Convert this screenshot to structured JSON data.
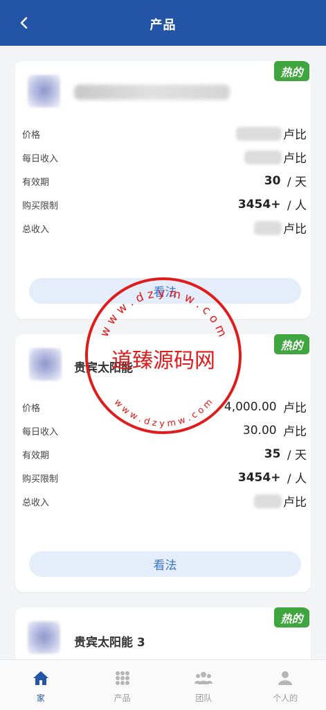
{
  "header": {
    "title": "产品"
  },
  "hot_badge": "热的",
  "labels": {
    "price": "价格",
    "daily": "每日收入",
    "validity": "有效期",
    "limit": "购买限制",
    "total": "总收入"
  },
  "cards": [
    {
      "name": "",
      "price": "",
      "price_unit": "卢比",
      "daily": "",
      "daily_unit": "卢比",
      "validity": "30",
      "validity_unit": "/ 天",
      "limit": "3454+",
      "limit_unit": "/ 人",
      "total": "",
      "total_unit": "卢比",
      "button": "看法"
    },
    {
      "name": "贵宾太阳能",
      "price": "4,000.00",
      "price_unit": "卢比",
      "daily": "30.00",
      "daily_unit": "卢比",
      "validity": "35",
      "validity_unit": "/ 天",
      "limit": "3454+",
      "limit_unit": "/ 人",
      "total": "",
      "total_unit": "卢比",
      "button": "看法"
    },
    {
      "name": "贵宾太阳能 3"
    }
  ],
  "tabbar": [
    {
      "label": "家",
      "icon": "home-icon",
      "active": true
    },
    {
      "label": "产品",
      "icon": "grid-icon",
      "active": false
    },
    {
      "label": "团队",
      "icon": "team-icon",
      "active": false
    },
    {
      "label": "个人的",
      "icon": "user-icon",
      "active": false
    }
  ],
  "watermark": {
    "text": "道臻源码网",
    "url_top": "w w w . d z y m w . c o m",
    "url_bottom": "w w w . d z y m w . c o m"
  },
  "colors": {
    "header": "#2354a6",
    "hot": "#3fa53f",
    "button_bg": "#e4edf9",
    "button_text": "#3a74cf",
    "watermark": "#e01b1b"
  }
}
